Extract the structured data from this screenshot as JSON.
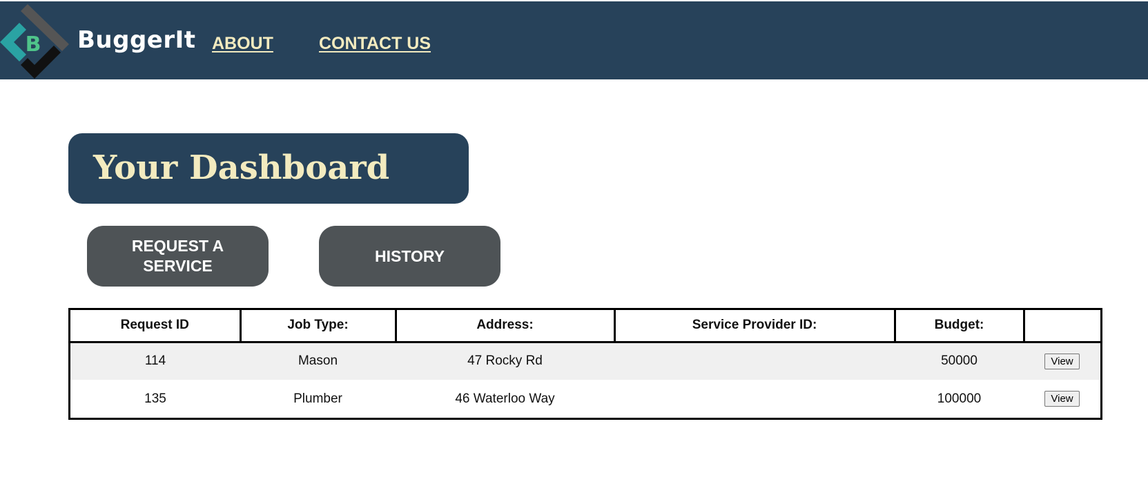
{
  "header": {
    "brand": "BuggerIt",
    "logo_letter": "B",
    "nav": {
      "about": "ABOUT",
      "contact": "CONTACT US"
    }
  },
  "dashboard": {
    "title": "Your Dashboard",
    "actions": {
      "request_line1": "REQUEST A",
      "request_line2": "SERVICE",
      "history": "HISTORY"
    }
  },
  "table": {
    "headers": {
      "request_id": "Request ID",
      "job_type": "Job Type:",
      "address": "Address:",
      "provider_id": "Service Provider ID:",
      "budget": "Budget:",
      "action": ""
    },
    "rows": [
      {
        "request_id": "114",
        "job_type": "Mason",
        "address": "47 Rocky Rd",
        "provider_id": "",
        "budget": "50000",
        "action": "View"
      },
      {
        "request_id": "135",
        "job_type": "Plumber",
        "address": "46 Waterloo Way",
        "provider_id": "",
        "budget": "100000",
        "action": "View"
      }
    ]
  },
  "colors": {
    "header_bg": "#27425a",
    "accent_text": "#f3ebbf",
    "button_bg": "#4e5356",
    "logo_teal": "#2aa3a3",
    "logo_green": "#4fc48a",
    "logo_gray": "#555555"
  }
}
